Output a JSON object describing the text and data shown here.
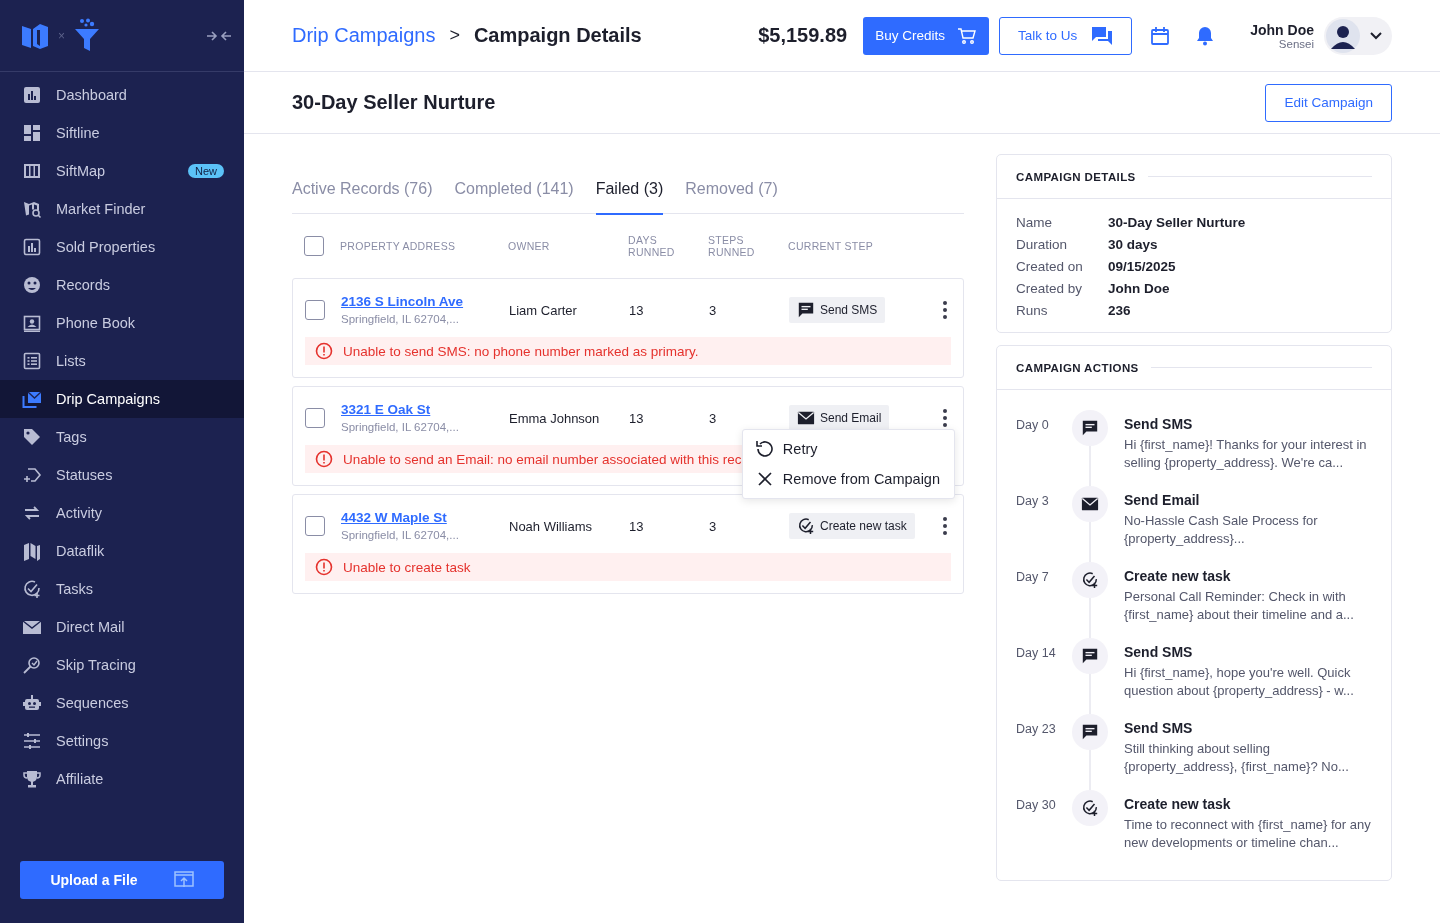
{
  "sidebar": {
    "items": [
      {
        "label": "Dashboard",
        "selected": false
      },
      {
        "label": "Siftline",
        "selected": false
      },
      {
        "label": "SiftMap",
        "selected": false,
        "badge": "New"
      },
      {
        "label": "Market Finder",
        "selected": false
      },
      {
        "label": "Sold Properties",
        "selected": false
      },
      {
        "label": "Records",
        "selected": false
      },
      {
        "label": "Phone Book",
        "selected": false
      },
      {
        "label": "Lists",
        "selected": false
      },
      {
        "label": "Drip Campaigns",
        "selected": true
      },
      {
        "label": "Tags",
        "selected": false
      },
      {
        "label": "Statuses",
        "selected": false
      },
      {
        "label": "Activity",
        "selected": false
      },
      {
        "label": "Dataflik",
        "selected": false
      },
      {
        "label": "Tasks",
        "selected": false
      },
      {
        "label": "Direct Mail",
        "selected": false
      },
      {
        "label": "Skip Tracing",
        "selected": false
      },
      {
        "label": "Sequences",
        "selected": false
      },
      {
        "label": "Settings",
        "selected": false
      },
      {
        "label": "Affiliate",
        "selected": false
      }
    ],
    "logo_separator": "×",
    "upload_button": "Upload a File"
  },
  "header": {
    "breadcrumb": [
      "Drip Campaigns",
      "Campaign Details"
    ],
    "breadcrumb_separator": ">",
    "balance": "$5,159.89",
    "buy_credits": "Buy Credits",
    "talk_to_us": "Talk to Us",
    "user": {
      "name": "John Doe",
      "role": "Sensei"
    }
  },
  "page": {
    "title": "30-Day Seller Nurture",
    "edit_button": "Edit Campaign"
  },
  "tabs": [
    {
      "label": "Active Records (76)",
      "selected": false
    },
    {
      "label": "Completed (141)",
      "selected": false
    },
    {
      "label": "Failed (3)",
      "selected": true
    },
    {
      "label": "Removed (7)",
      "selected": false
    }
  ],
  "table": {
    "select_all_checked": false,
    "columns": [
      "PROPERTY ADDRESS",
      "OWNER",
      "DAYS\nRUNNED",
      "STEPS\nRUNNED",
      "CURRENT STEP"
    ],
    "rows": [
      {
        "checked": false,
        "address": "2136 S Lincoln Ave",
        "city": "Springfield, IL 62704,...",
        "owner": "Liam Carter",
        "days": "13",
        "steps": "3",
        "step": {
          "kind": "sms",
          "label": "Send SMS"
        },
        "error": "Unable to send SMS: no phone number marked as primary.",
        "menu_open": false
      },
      {
        "checked": false,
        "address": "3321 E Oak St",
        "city": "Springfield, IL 62704,...",
        "owner": "Emma Johnson",
        "days": "13",
        "steps": "3",
        "step": {
          "kind": "email",
          "label": "Send Email"
        },
        "error": "Unable to send an Email: no email number associated with this rec",
        "menu_open": true
      },
      {
        "checked": false,
        "address": "4432 W Maple St",
        "city": "Springfield, IL 62704,...",
        "owner": "Noah Williams",
        "days": "13",
        "steps": "3",
        "step": {
          "kind": "task",
          "label": "Create new task"
        },
        "error": "Unable to create task",
        "menu_open": false
      }
    ]
  },
  "row_menu": [
    {
      "kind": "retry",
      "label": "Retry"
    },
    {
      "kind": "remove",
      "label": "Remove from Campaign"
    }
  ],
  "campaign_details": {
    "title": "CAMPAIGN DETAILS",
    "fields": [
      {
        "label": "Name",
        "value": "30-Day Seller Nurture"
      },
      {
        "label": "Duration",
        "value": "30 days"
      },
      {
        "label": "Created on",
        "value": "09/15/2025"
      },
      {
        "label": "Created by",
        "value": "John Doe"
      },
      {
        "label": "Runs",
        "value": "236"
      }
    ]
  },
  "campaign_actions": {
    "title": "CAMPAIGN ACTIONS",
    "items": [
      {
        "day": "Day 0",
        "kind": "sms",
        "title": "Send SMS",
        "text": "Hi {first_name}! Thanks for your interest in selling {property_address}. We're ca..."
      },
      {
        "day": "Day 3",
        "kind": "email",
        "title": "Send Email",
        "text": "No-Hassle Cash Sale Process for {property_address}..."
      },
      {
        "day": "Day 7",
        "kind": "task",
        "title": "Create new task",
        "text": "Personal Call Reminder: Check in with {first_name} about their timeline and a..."
      },
      {
        "day": "Day 14",
        "kind": "sms",
        "title": "Send SMS",
        "text": "Hi {first_name}, hope you're well. Quick question about {property_address} - w..."
      },
      {
        "day": "Day 23",
        "kind": "sms",
        "title": "Send SMS",
        "text": "Still thinking about selling {property_address}, {first_name}? No..."
      },
      {
        "day": "Day 30",
        "kind": "task",
        "title": "Create new task",
        "text": "Time to reconnect with {first_name} for any new developments or timeline chan..."
      }
    ]
  }
}
